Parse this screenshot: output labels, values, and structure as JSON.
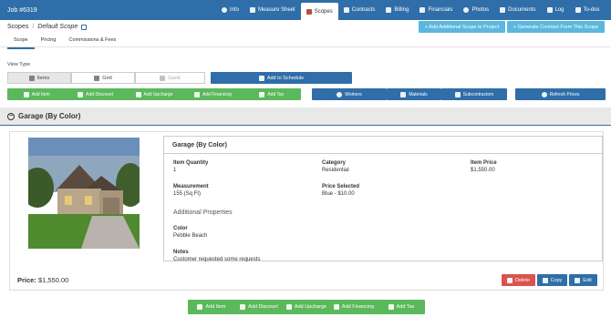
{
  "header": {
    "job": "Job #6319",
    "nav": [
      {
        "label": "Info",
        "icon": "info-icon"
      },
      {
        "label": "Measure Sheet",
        "icon": "ruler-icon"
      },
      {
        "label": "Scopes",
        "icon": "scopes-icon",
        "active": true
      },
      {
        "label": "Contracts",
        "icon": "pen-icon"
      },
      {
        "label": "Billing",
        "icon": "billing-icon"
      },
      {
        "label": "Financials",
        "icon": "financials-icon"
      },
      {
        "label": "Photos",
        "icon": "camera-icon"
      },
      {
        "label": "Documents",
        "icon": "documents-icon"
      },
      {
        "label": "Log",
        "icon": "log-icon"
      },
      {
        "label": "To-dos",
        "icon": "list-icon"
      }
    ]
  },
  "breadcrumb": {
    "root": "Scopes",
    "sep": "/",
    "current": "Default Scope"
  },
  "actions": {
    "add_scope": "+ Add Additional Scope to Project",
    "gen_contract": "+ Generate Contract From This Scope"
  },
  "subtabs": [
    "Scope",
    "Pricing",
    "Commissions & Fees"
  ],
  "view": {
    "label": "View Type",
    "items": "Items",
    "grid": "Grid",
    "gantt": "Gantt",
    "schedule": "Add to Schedule"
  },
  "toolbar": {
    "green": [
      "Add Item",
      "Add Discount",
      "Add Upcharge",
      "Add Financing",
      "Add Tax"
    ],
    "workers": "Workers",
    "materials": "Materials",
    "subcontractors": "Subcontractors",
    "refresh": "Refresh Prices"
  },
  "section": {
    "title": "Garage (By Color)"
  },
  "card": {
    "title": "Garage (By Color)",
    "item_quantity_label": "Item Quantity",
    "item_quantity": "1",
    "category_label": "Category",
    "category": "Residential",
    "item_price_label": "Item Price",
    "item_price": "$1,550.00",
    "measurement_label": "Measurement",
    "measurement": "155 (Sq Ft)",
    "price_selected_label": "Price Selected",
    "price_selected": "Blue - $10.00",
    "additional": "Additional Properties",
    "color_label": "Color",
    "color": "Pebble Beach",
    "notes_label": "Notes",
    "notes": "Customer requested some requests",
    "price_label": "Price:",
    "price": "$1,550.00",
    "delete": "Delete",
    "copy": "Copy",
    "edit": "Edit"
  },
  "bottombar": [
    "Add Item",
    "Add Discount",
    "Add Upcharge",
    "Add Financing",
    "Add Tax"
  ],
  "colors": {
    "primary": "#2f6ea8",
    "green": "#5cb85c",
    "info": "#5bb7de",
    "danger": "#d9534f"
  }
}
